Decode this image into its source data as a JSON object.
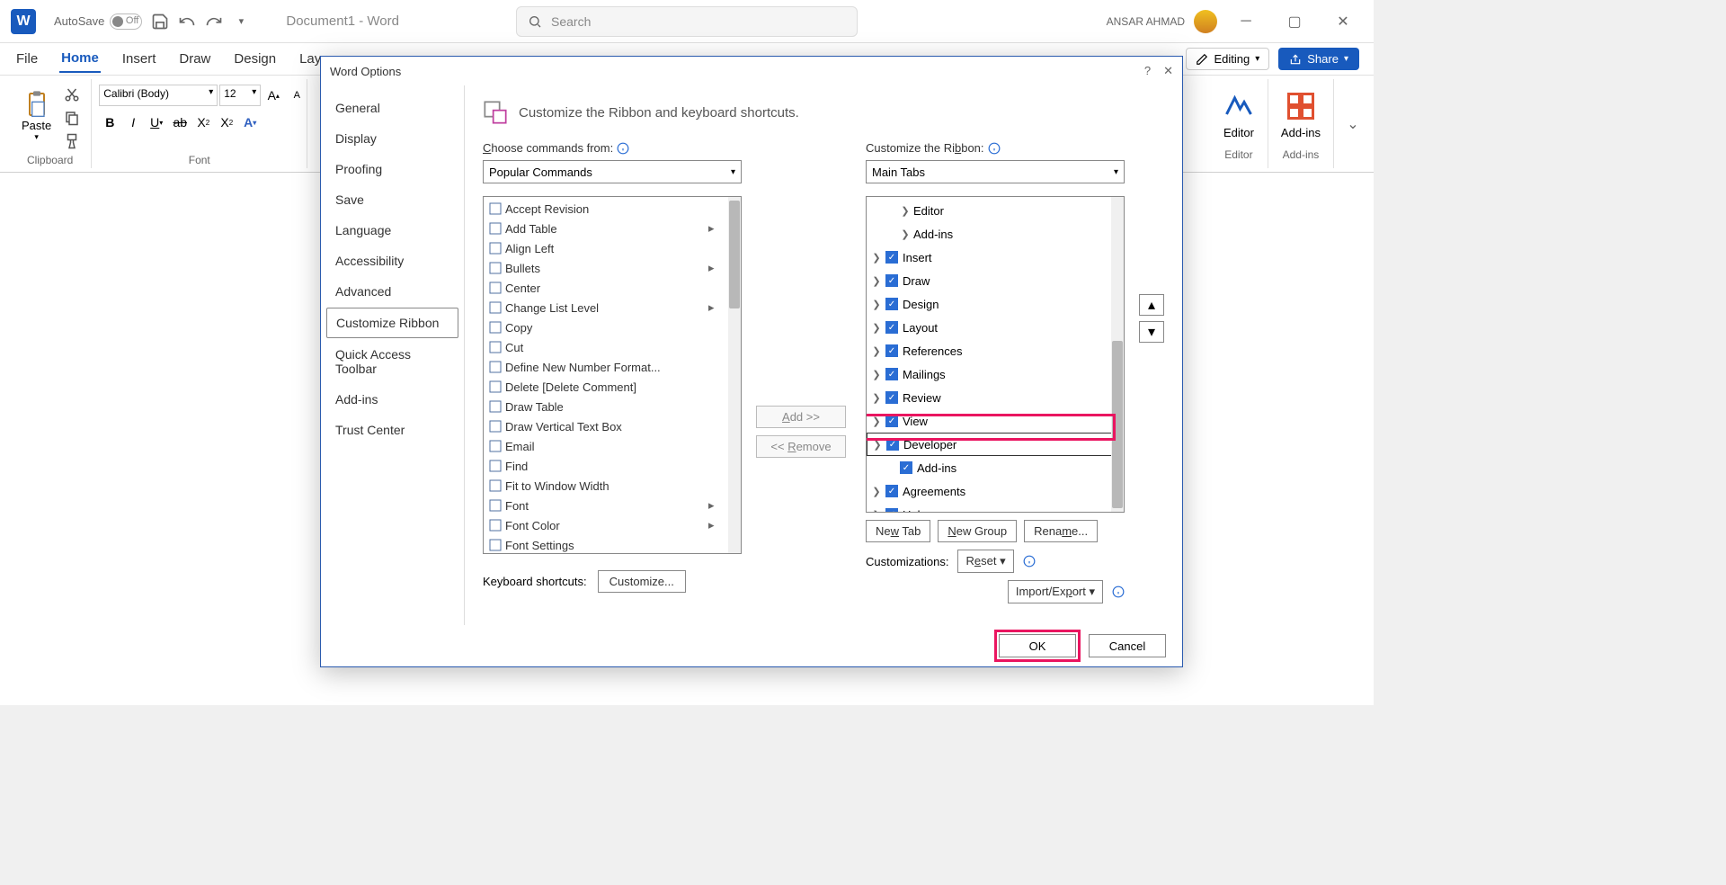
{
  "titleBar": {
    "autoSave": "AutoSave",
    "off": "Off",
    "docTitle": "Document1 - Word",
    "searchPlaceholder": "Search",
    "userName": "ANSAR AHMAD"
  },
  "ribbon": {
    "tabs": [
      "File",
      "Home",
      "Insert",
      "Draw",
      "Design",
      "Layo"
    ],
    "editing": "Editing",
    "share": "Share",
    "groups": {
      "clipboard": "Clipboard",
      "paste": "Paste",
      "font": "Font",
      "fontName": "Calibri (Body)",
      "fontSize": "12",
      "editor": "Editor",
      "editorLabel": "Editor",
      "addins": "Add-ins",
      "addinsLabel": "Add-ins"
    }
  },
  "dialog": {
    "title": "Word Options",
    "nav": [
      "General",
      "Display",
      "Proofing",
      "Save",
      "Language",
      "Accessibility",
      "Advanced",
      "Customize Ribbon",
      "Quick Access Toolbar",
      "Add-ins",
      "Trust Center"
    ],
    "sectionTitle": "Customize the Ribbon and keyboard shortcuts.",
    "chooseCommands": "Choose commands from:",
    "popularCommands": "Popular Commands",
    "customizeRibbon": "Customize the Ribbon:",
    "mainTabs": "Main Tabs",
    "commands": [
      "Accept Revision",
      "Add Table",
      "Align Left",
      "Bullets",
      "Center",
      "Change List Level",
      "Copy",
      "Cut",
      "Define New Number Format...",
      "Delete [Delete Comment]",
      "Draw Table",
      "Draw Vertical Text Box",
      "Email",
      "Find",
      "Fit to Window Width",
      "Font",
      "Font Color",
      "Font Settings"
    ],
    "tree": [
      {
        "label": "Editor",
        "indent": 2
      },
      {
        "label": "Add-ins",
        "indent": 2
      },
      {
        "label": "Insert",
        "indent": 0,
        "check": true
      },
      {
        "label": "Draw",
        "indent": 0,
        "check": true
      },
      {
        "label": "Design",
        "indent": 0,
        "check": true
      },
      {
        "label": "Layout",
        "indent": 0,
        "check": true
      },
      {
        "label": "References",
        "indent": 0,
        "check": true
      },
      {
        "label": "Mailings",
        "indent": 0,
        "check": true
      },
      {
        "label": "Review",
        "indent": 0,
        "check": true
      },
      {
        "label": "View",
        "indent": 0,
        "check": true
      },
      {
        "label": "Developer",
        "indent": 0,
        "check": true,
        "selected": true
      },
      {
        "label": "Add-ins",
        "indent": 1,
        "check": true,
        "noExpand": true
      },
      {
        "label": "Agreements",
        "indent": 0,
        "check": true
      },
      {
        "label": "Help",
        "indent": 0,
        "check": true
      }
    ],
    "addBtn": "Add >>",
    "removeBtn": "<< Remove",
    "newTab": "New Tab",
    "newGroup": "New Group",
    "rename": "Rename...",
    "customizations": "Customizations:",
    "reset": "Reset",
    "importExport": "Import/Export",
    "keyboardShortcuts": "Keyboard shortcuts:",
    "customize": "Customize...",
    "ok": "OK",
    "cancel": "Cancel"
  }
}
